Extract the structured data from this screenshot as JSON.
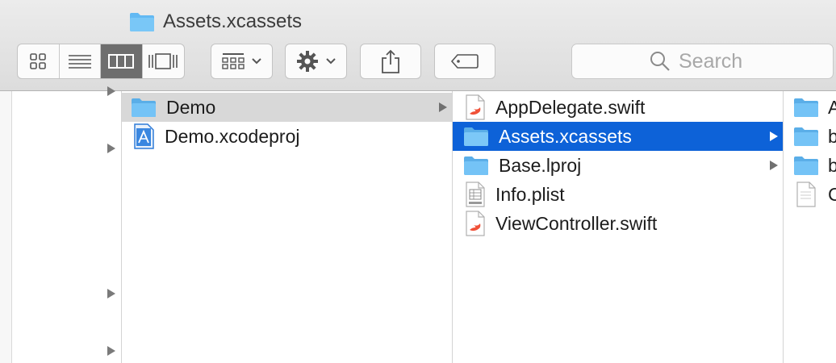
{
  "window": {
    "title": "Assets.xcassets"
  },
  "toolbar": {
    "view_modes": [
      "icon-view",
      "list-view",
      "column-view",
      "cover-flow-view"
    ],
    "active_view": "column-view"
  },
  "search": {
    "placeholder": "Search"
  },
  "columns": {
    "col1": [
      {
        "label": "Demo",
        "icon": "folder-icon",
        "selected": true,
        "has_children": true
      },
      {
        "label": "Demo.xcodeproj",
        "icon": "xcodeproj-icon",
        "selected": false,
        "has_children": false
      }
    ],
    "col2": [
      {
        "label": "AppDelegate.swift",
        "icon": "swift-file-icon",
        "selected": false,
        "has_children": false
      },
      {
        "label": "Assets.xcassets",
        "icon": "folder-icon",
        "selected": true,
        "has_children": true
      },
      {
        "label": "Base.lproj",
        "icon": "folder-icon",
        "selected": false,
        "has_children": true
      },
      {
        "label": "Info.plist",
        "icon": "plist-file-icon",
        "selected": false,
        "has_children": false
      },
      {
        "label": "ViewController.swift",
        "icon": "swift-file-icon",
        "selected": false,
        "has_children": false
      }
    ],
    "col3": [
      {
        "label": "A",
        "icon": "folder-icon"
      },
      {
        "label": "b",
        "icon": "folder-icon"
      },
      {
        "label": "b",
        "icon": "folder-icon"
      },
      {
        "label": "C",
        "icon": "generic-file-icon"
      }
    ]
  },
  "colors": {
    "selection_blue": "#0d62d8",
    "selection_gray": "#d8d8d8",
    "folder": "#5fb8f2"
  }
}
